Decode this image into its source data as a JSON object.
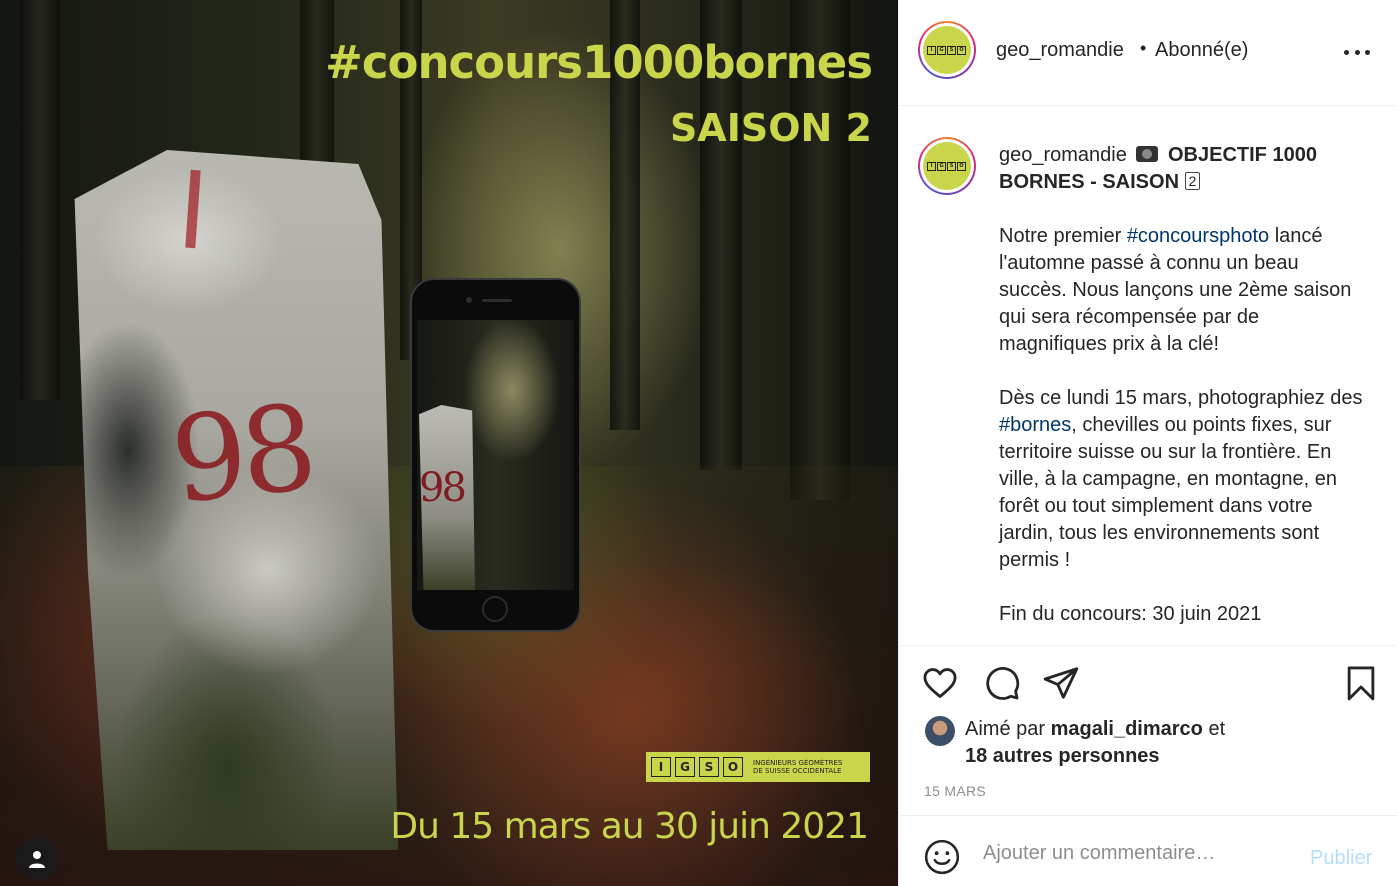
{
  "image": {
    "headline": "#concours1000bornes",
    "season": "SAISON 2",
    "dates": "Du 15 mars au 30 juin 2021",
    "stone_number": "98",
    "phone_stone_number": "98",
    "badge_letters": [
      "I",
      "G",
      "S",
      "O"
    ],
    "badge_text_line1": "INGÉNIEURS GÉOMÈTRES",
    "badge_text_line2": "DE SUISSE OCCIDENTALE",
    "accent_color": "#c9d54a"
  },
  "header": {
    "username": "geo_romandie",
    "separator": "•",
    "follow_status": "Abonné(e)",
    "avatar_letters": [
      "I",
      "G",
      "S",
      "O"
    ]
  },
  "caption": {
    "username": "geo_romandie",
    "title_part1": "OBJECTIF 1000 BORNES - SAISON",
    "title_keycap": "2",
    "p1_before": "Notre premier ",
    "p1_hashtag": "#concoursphoto",
    "p1_after": " lancé l'automne passé à connu un beau succès. Nous lançons une 2ème saison qui sera récompensée par de magnifiques prix à la clé!",
    "p2_before": "Dès ce lundi 15 mars, photographiez des ",
    "p2_hashtag": "#bornes",
    "p2_after": ", chevilles ou points fixes, sur territoire suisse ou sur la frontière. En ville, à la campagne, en montagne, en forêt ou tout simplement dans votre jardin, tous les environnements sont permis !",
    "p3": "Fin du concours: 30 juin 2021"
  },
  "likes": {
    "prefix": "Aimé par ",
    "liker": "magali_dimarco",
    "middle": " et",
    "others": "18 autres personnes"
  },
  "post_date": "15 MARS",
  "comment": {
    "placeholder": "Ajouter un commentaire…",
    "publish_label": "Publier"
  }
}
